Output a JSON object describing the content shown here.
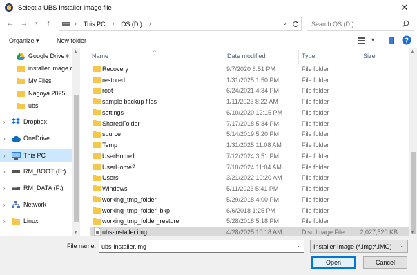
{
  "window": {
    "title": "Select a UBS Installer image file",
    "close_glyph": "✕"
  },
  "address": {
    "segments": [
      "This PC",
      "OS (D:)"
    ],
    "search_placeholder": "Search OS (D:)"
  },
  "toolbar": {
    "organize_label": "Organize ▾",
    "new_folder_label": "New folder"
  },
  "sidebar": {
    "items": [
      {
        "label": "Google Drive",
        "icon": "google-drive-icon"
      },
      {
        "label": "installer image d",
        "icon": "folder-icon"
      },
      {
        "label": "My Files",
        "icon": "folder-icon"
      },
      {
        "label": "Nagoya 2025",
        "icon": "folder-icon"
      },
      {
        "label": "ubs",
        "icon": "folder-icon"
      },
      {
        "label": "Dropbox",
        "icon": "dropbox-icon"
      },
      {
        "label": "OneDrive",
        "icon": "onedrive-icon"
      },
      {
        "label": "This PC",
        "icon": "this-pc-icon"
      },
      {
        "label": "RM_BOOT (E:)",
        "icon": "drive-icon"
      },
      {
        "label": "RM_DATA (F:)",
        "icon": "drive-icon"
      },
      {
        "label": "Network",
        "icon": "network-icon"
      },
      {
        "label": "Linux",
        "icon": "folder-icon"
      }
    ]
  },
  "columns": {
    "name": "Name",
    "date": "Date modified",
    "type": "Type",
    "size": "Size"
  },
  "files": [
    {
      "name": "Recovery",
      "date": "9/7/2020 6:51 PM",
      "type": "File folder",
      "size": ""
    },
    {
      "name": "restored",
      "date": "1/31/2025 1:50 PM",
      "type": "File folder",
      "size": ""
    },
    {
      "name": "root",
      "date": "6/24/2021 4:34 PM",
      "type": "File folder",
      "size": ""
    },
    {
      "name": "sample backup files",
      "date": "1/11/2023 8:22 AM",
      "type": "File folder",
      "size": ""
    },
    {
      "name": "settings",
      "date": "6/10/2020 12:15 PM",
      "type": "File folder",
      "size": ""
    },
    {
      "name": "SharedFolder",
      "date": "7/17/2018 5:34 PM",
      "type": "File folder",
      "size": ""
    },
    {
      "name": "source",
      "date": "5/14/2019 5:20 PM",
      "type": "File folder",
      "size": ""
    },
    {
      "name": "Temp",
      "date": "1/31/2025 11:08 AM",
      "type": "File folder",
      "size": ""
    },
    {
      "name": "UserHome1",
      "date": "7/12/2024 3:51 PM",
      "type": "File folder",
      "size": ""
    },
    {
      "name": "UserHome2",
      "date": "7/10/2024 11:04 AM",
      "type": "File folder",
      "size": ""
    },
    {
      "name": "Users",
      "date": "3/21/2022 10:20 AM",
      "type": "File folder",
      "size": ""
    },
    {
      "name": "Windows",
      "date": "5/11/2023 5:41 PM",
      "type": "File folder",
      "size": ""
    },
    {
      "name": "working_tmp_folder",
      "date": "5/29/2018 4:00 PM",
      "type": "File folder",
      "size": ""
    },
    {
      "name": "working_tmp_folder_bkp",
      "date": "6/6/2018 1:25 PM",
      "type": "File folder",
      "size": ""
    },
    {
      "name": "working_tmp_folder_restore",
      "date": "5/28/2018 5:18 PM",
      "type": "File folder",
      "size": ""
    },
    {
      "name": "ubs-installer.img",
      "date": "4/28/2025 10:18 AM",
      "type": "Disc Image File",
      "size": "2,027,520 KB"
    }
  ],
  "footer": {
    "filename_label": "File name:",
    "filename_value": "ubs-installer.img",
    "filter_value": "Installer Image (*.img;*.IMG)",
    "open_label": "Open",
    "cancel_label": "Cancel"
  },
  "colors": {
    "folder": "#f5c84c",
    "selection": "#cce8ff",
    "accent": "#0078d7"
  }
}
